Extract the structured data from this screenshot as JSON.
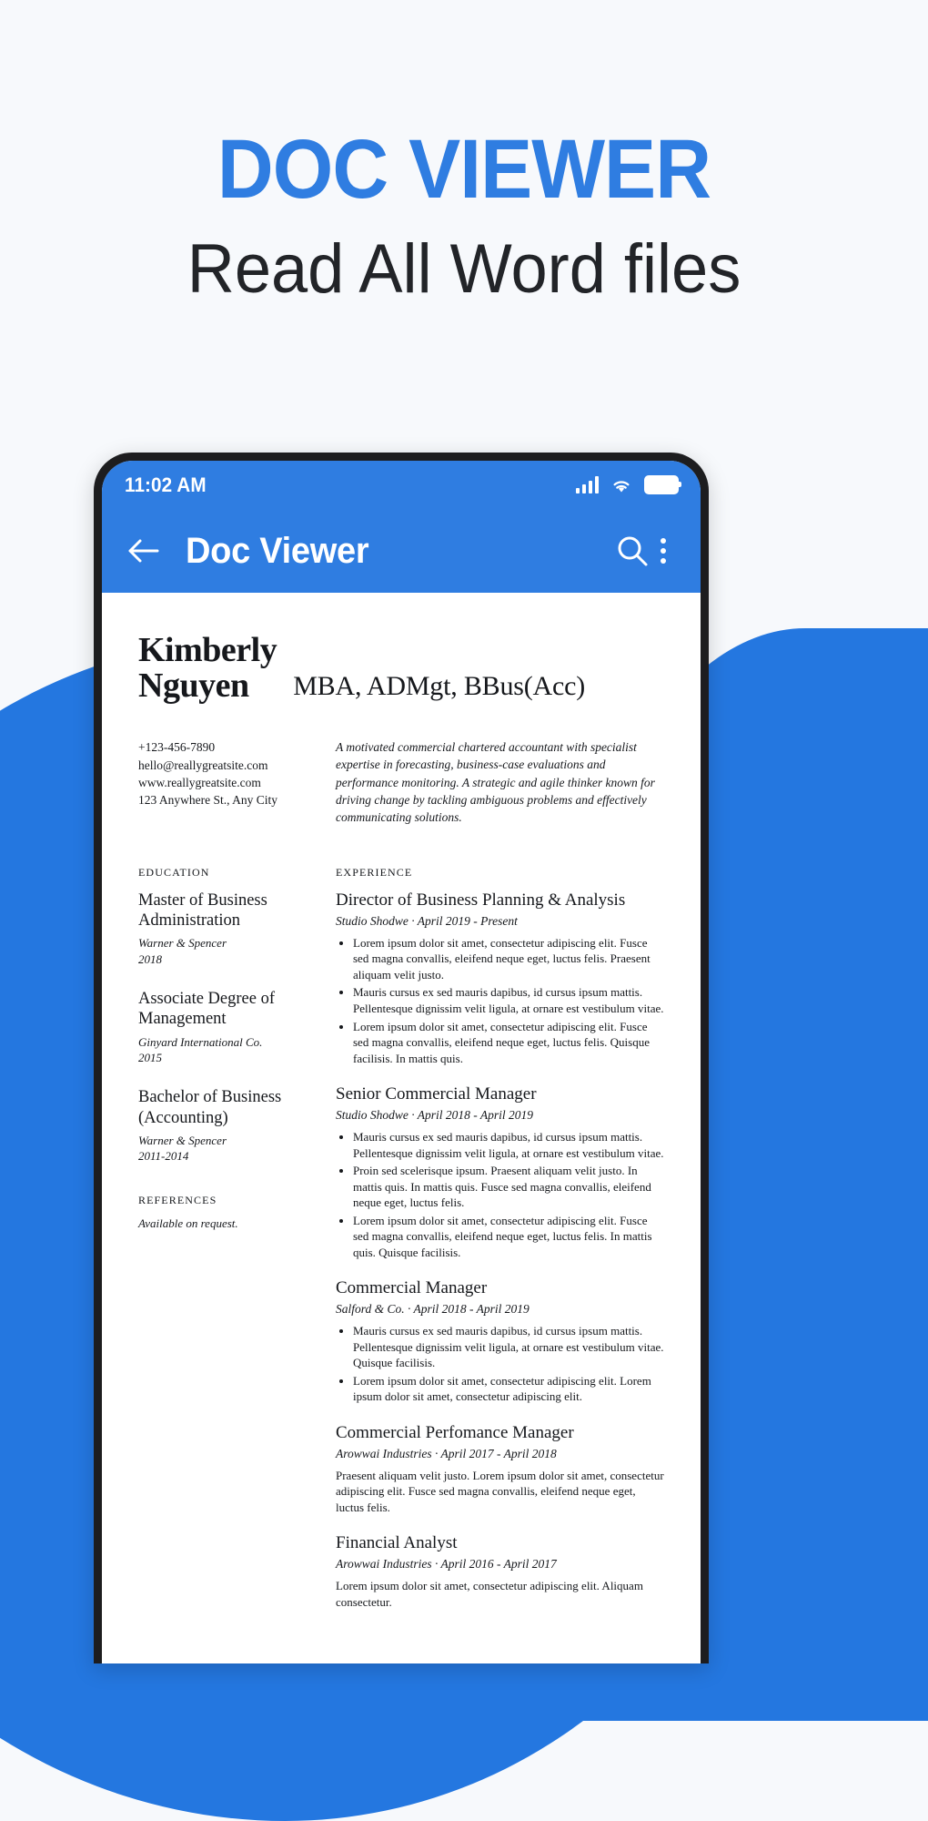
{
  "promo": {
    "headline": "DOC VIEWER",
    "subheadline": "Read All Word files",
    "accent_color": "#2f7de1",
    "headline_color": "#2f7de1",
    "subheadline_color": "#222428",
    "background_color": "#f7f9fc"
  },
  "phone": {
    "statusbar": {
      "time": "11:02 AM",
      "icons": [
        "signal-icon",
        "wifi-icon",
        "battery-icon"
      ]
    },
    "appbar": {
      "back_icon": "back-arrow-icon",
      "title": "Doc Viewer",
      "search_icon": "search-icon",
      "overflow_icon": "overflow-menu-icon",
      "background_color": "#2f7de1"
    }
  },
  "document": {
    "name": "Kimberly\nNguyen",
    "credentials": "MBA, ADMgt, BBus(Acc)",
    "contact": [
      "+123-456-7890",
      "hello@reallygreatsite.com",
      "www.reallygreatsite.com",
      "123 Anywhere St., Any City"
    ],
    "summary": "A motivated commercial chartered accountant with specialist expertise in forecasting, business-case evaluations and performance monitoring. A strategic and agile thinker known for driving change by tackling ambiguous problems and effectively communicating solutions.",
    "education_label": "EDUCATION",
    "education": [
      {
        "title": "Master of Business Administration",
        "institution": "Warner & Spencer",
        "year": "2018"
      },
      {
        "title": "Associate Degree of Management",
        "institution": "Ginyard International Co.",
        "year": "2015"
      },
      {
        "title": "Bachelor of Business (Accounting)",
        "institution": "Warner & Spencer",
        "year": "2011-2014"
      }
    ],
    "references_label": "REFERENCES",
    "references_text": "Available on request.",
    "experience_label": "EXPERIENCE",
    "experience": [
      {
        "title": "Director of Business Planning & Analysis",
        "meta": "Studio Shodwe · April 2019 - Present",
        "bullets": [
          "Lorem ipsum dolor sit amet, consectetur adipiscing elit. Fusce sed magna convallis, eleifend neque eget, luctus felis. Praesent aliquam velit justo.",
          "Mauris cursus ex sed mauris dapibus, id cursus ipsum mattis. Pellentesque dignissim velit ligula, at ornare est vestibulum vitae.",
          "Lorem ipsum dolor sit amet, consectetur adipiscing elit. Fusce sed magna convallis, eleifend neque eget, luctus felis. Quisque facilisis. In mattis quis."
        ],
        "paragraph": ""
      },
      {
        "title": "Senior Commercial Manager",
        "meta": "Studio Shodwe · April 2018 - April 2019",
        "bullets": [
          "Mauris cursus ex sed mauris dapibus, id cursus ipsum mattis. Pellentesque dignissim velit ligula, at ornare est vestibulum vitae.",
          "Proin sed scelerisque ipsum. Praesent aliquam velit justo. In mattis quis. In mattis quis.  Fusce sed magna convallis, eleifend neque eget, luctus felis.",
          "Lorem ipsum dolor sit amet, consectetur adipiscing elit. Fusce sed magna convallis, eleifend neque eget, luctus felis. In mattis quis. Quisque facilisis."
        ],
        "paragraph": ""
      },
      {
        "title": "Commercial Manager",
        "meta": "Salford & Co. · April 2018 - April 2019",
        "bullets": [
          "Mauris cursus ex sed mauris dapibus, id cursus ipsum mattis. Pellentesque dignissim velit ligula, at ornare est vestibulum vitae. Quisque facilisis.",
          "Lorem ipsum dolor sit amet, consectetur adipiscing elit. Lorem ipsum dolor sit amet, consectetur adipiscing elit."
        ],
        "paragraph": ""
      },
      {
        "title": "Commercial Perfomance Manager",
        "meta": "Arowwai Industries · April 2017 - April 2018",
        "bullets": [],
        "paragraph": "Praesent aliquam velit justo. Lorem ipsum dolor sit amet, consectetur adipiscing elit. Fusce sed magna convallis, eleifend neque eget, luctus felis."
      },
      {
        "title": "Financial Analyst",
        "meta": "Arowwai Industries · April 2016 - April 2017",
        "bullets": [],
        "paragraph": "Lorem ipsum dolor sit amet, consectetur adipiscing elit. Aliquam consectetur."
      }
    ]
  }
}
